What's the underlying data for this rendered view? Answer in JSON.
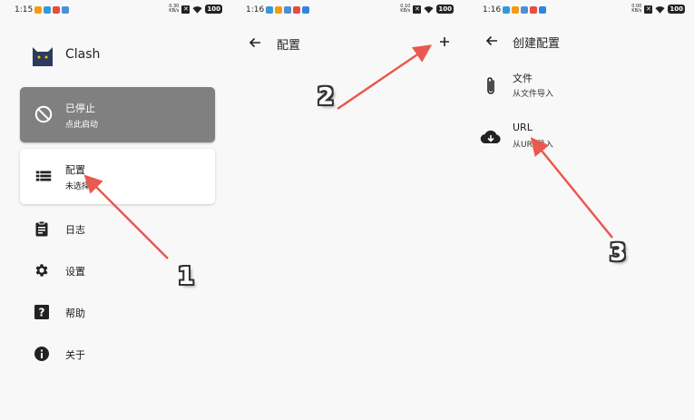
{
  "colors": {
    "stopped_card": "#808080",
    "arrow": "#e8594f",
    "cat_logo": "#2d3a5c"
  },
  "screen1": {
    "status_time": "1:15",
    "status_speed": "0.30\nKB/s",
    "battery": "100",
    "app_name": "Clash",
    "stopped_card": {
      "title": "已停止",
      "subtitle": "点此启动"
    },
    "profile_card": {
      "title": "配置",
      "subtitle": "未选择"
    },
    "menu": [
      {
        "label": "日志",
        "icon": "clipboard-icon"
      },
      {
        "label": "设置",
        "icon": "gear-icon"
      },
      {
        "label": "帮助",
        "icon": "help-icon"
      },
      {
        "label": "关于",
        "icon": "info-icon"
      }
    ]
  },
  "screen2": {
    "status_time": "1:16",
    "status_speed": "0.10\nKB/s",
    "battery": "100",
    "title": "配置"
  },
  "screen3": {
    "status_time": "1:16",
    "status_speed": "0.00\nKB/s",
    "battery": "100",
    "title": "创建配置",
    "items": [
      {
        "title": "文件",
        "subtitle": "从文件导入",
        "icon": "paperclip-icon"
      },
      {
        "title": "URL",
        "subtitle": "从URL导入",
        "icon": "cloud-download-icon"
      }
    ]
  },
  "annotations": [
    "1",
    "2",
    "3"
  ]
}
